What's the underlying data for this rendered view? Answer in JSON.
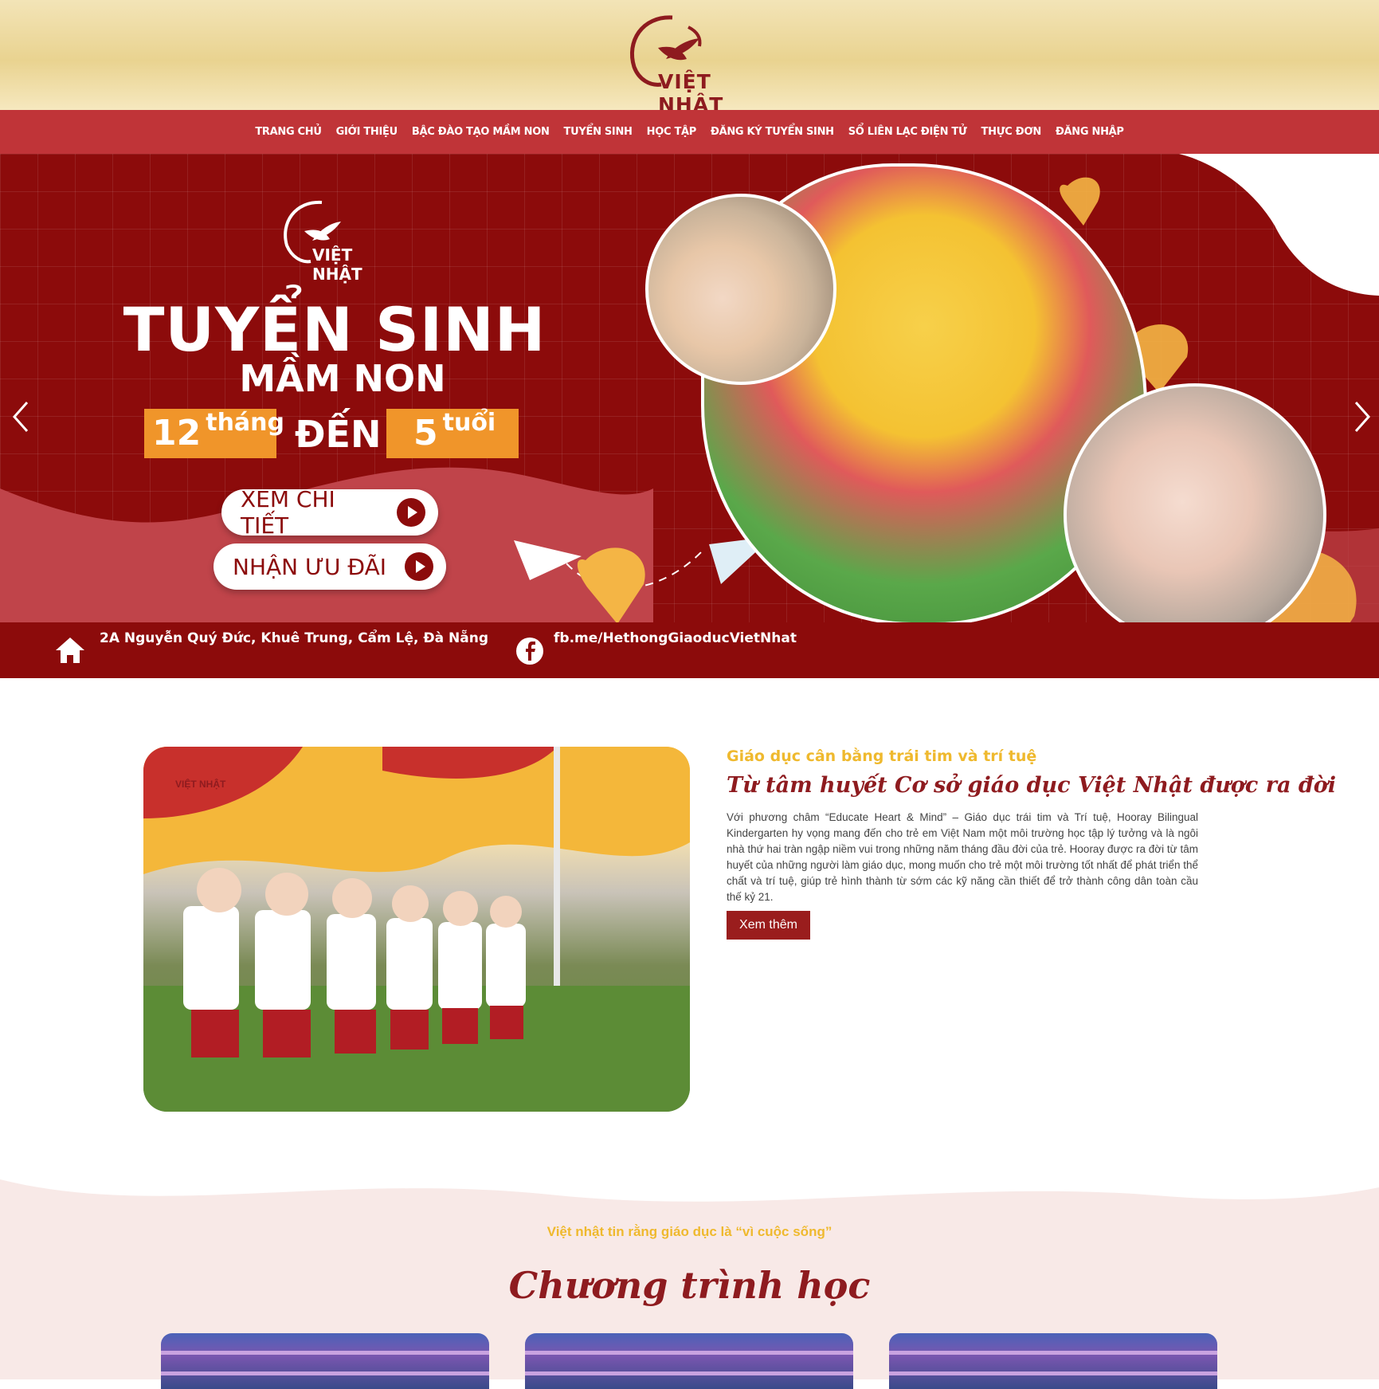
{
  "brand": {
    "logo_text": "VIỆT NHẬT"
  },
  "nav": {
    "items": [
      {
        "label": "TRANG CHỦ"
      },
      {
        "label": "GIỚI THIỆU"
      },
      {
        "label": "BẬC ĐÀO TẠO MẦM NON"
      },
      {
        "label": "TUYỂN SINH"
      },
      {
        "label": "HỌC TẬP"
      },
      {
        "label": "ĐĂNG KÝ TUYỂN SINH"
      },
      {
        "label": "SỔ LIÊN LẠC ĐIỆN TỬ"
      },
      {
        "label": "THỰC ĐƠN"
      },
      {
        "label": "ĐĂNG NHẬP"
      }
    ]
  },
  "hero": {
    "logo_text": "VIỆT NHẬT",
    "title": "TUYỂN SINH",
    "subtitle": "MẦM NON",
    "age_from_number": "12",
    "age_from_unit": "tháng",
    "age_to_word": "ĐẾN",
    "age_to_number": "5",
    "age_to_unit": "tuổi",
    "cta_primary": "XEM CHI TIẾT",
    "cta_secondary": "NHẬN ƯU ĐÃI",
    "address": "2A Nguyễn Quý Đức, Khuê Trung, Cẩm Lệ, Đà Nẵng",
    "facebook": "fb.me/HethongGiaoducVietNhat",
    "colors": {
      "primary": "#8c0b0b",
      "accent": "#f0952a",
      "gold": "#efb92e"
    }
  },
  "about": {
    "photo_logo": "VIỆT NHẬT",
    "eyebrow": "Giáo dục cân bằng trái tim và trí tuệ",
    "title": "Từ tâm huyết Cơ sở giáo dục Việt Nhật được ra đời",
    "body": "Với phương châm “Educate Heart & Mind” – Giáo dục trái tim và Trí tuệ, Hooray Bilingual Kindergarten hy vọng mang đến cho trẻ em Việt Nam một môi trường học tập lý tưởng và là ngôi nhà thứ hai tràn ngập niềm vui trong những năm tháng đầu đời của trẻ. Hooray được ra đời từ tâm huyết của những người làm giáo dục, mong muốn cho trẻ một môi trường tốt nhất để phát triển thể chất và trí tuệ, giúp trẻ hình thành từ sớm các kỹ năng cần thiết để trở thành công dân toàn cầu thế kỷ 21.",
    "button": "Xem thêm"
  },
  "program": {
    "eyebrow": "Việt nhật tin rằng giáo dục là “vì cuộc sống”",
    "title": "Chương trình học"
  }
}
